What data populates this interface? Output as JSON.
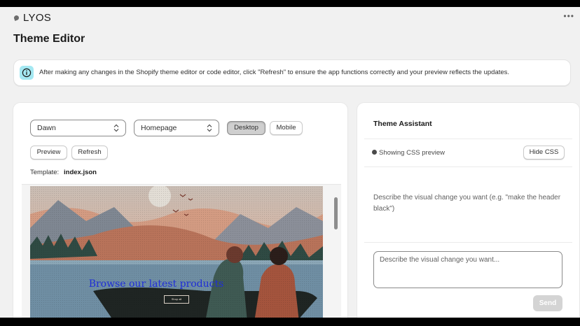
{
  "app": {
    "brand": "LYOS",
    "more_icon": "more-horizontal-icon",
    "page_title": "Theme Editor"
  },
  "banner": {
    "icon": "info-icon",
    "text": "After making any changes in the Shopify theme editor or code editor, click \"Refresh\" to ensure the app functions correctly and your preview reflects the updates."
  },
  "editor": {
    "theme_select": "Dawn",
    "page_select": "Homepage",
    "view_desktop": "Desktop",
    "view_mobile": "Mobile",
    "active_view": "Desktop",
    "preview_label": "Preview",
    "refresh_label": "Refresh",
    "template_label": "Template:",
    "template_value": "index.json",
    "hero_heading": "Browse our latest products",
    "hero_button": "Shop all"
  },
  "assistant": {
    "title": "Theme Assistant",
    "status": "Showing CSS preview",
    "hide_css": "Hide CSS",
    "hint": "Describe the visual change you want (e.g. \"make the header black\")",
    "input_placeholder": "Describe the visual change you want...",
    "send_label": "Send"
  },
  "colors": {
    "accent_info": "#a4e8f2",
    "hero_heading": "#1f2ed6",
    "active_toggle": "#cfcfcf"
  }
}
